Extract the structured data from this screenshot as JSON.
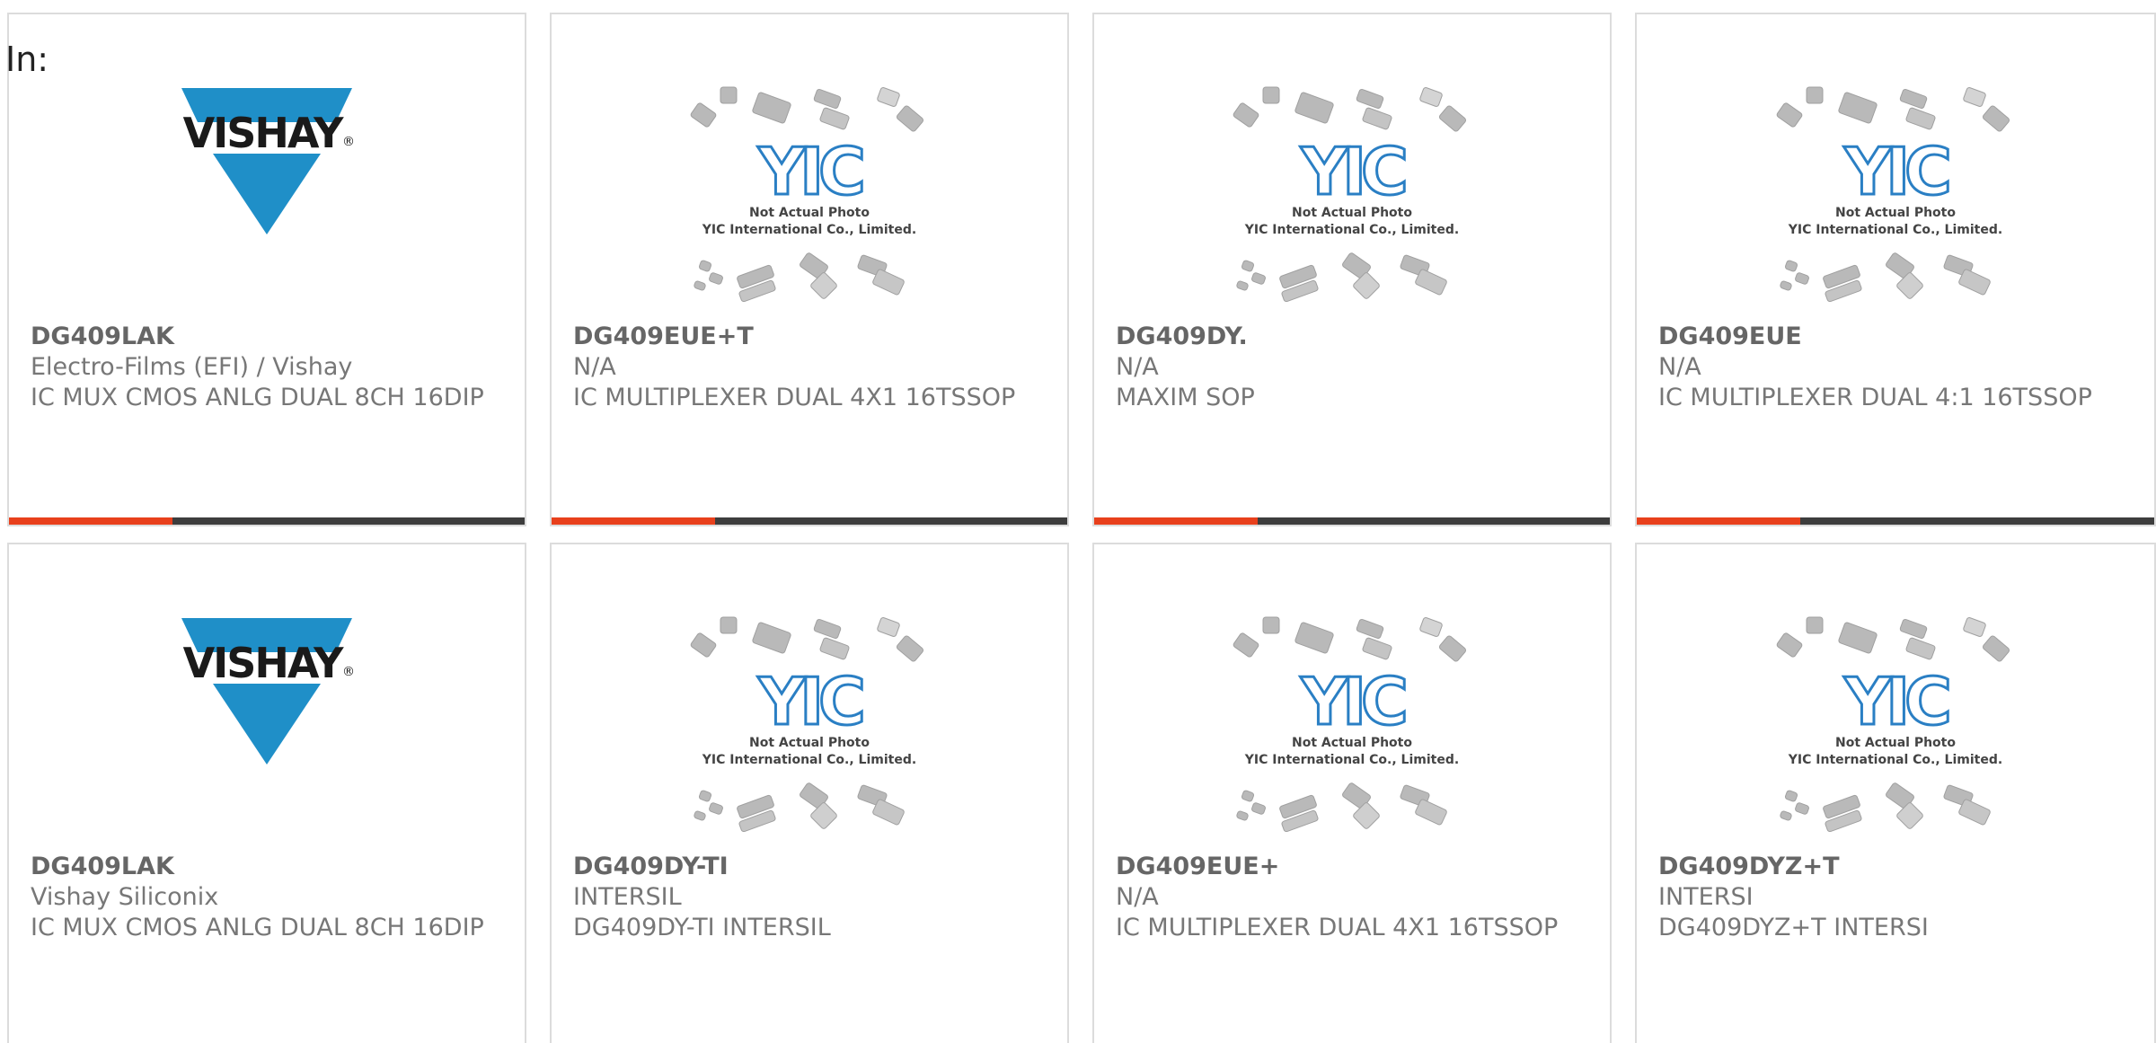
{
  "page": {
    "prefix_label": "In:"
  },
  "colors": {
    "accent": "#e8401c",
    "bar_dark": "#3d3d3d",
    "vishay_blue": "#1f8fc8",
    "yic_blue": "#2a7fc4"
  },
  "generic_image": {
    "caption_line1": "Not Actual Photo",
    "caption_line2": "YIC International Co., Limited.",
    "logo_text": "YIC"
  },
  "vishay_logo": {
    "text": "VISHAY",
    "mark": "®"
  },
  "products": [
    {
      "part_number": "DG409LAK",
      "manufacturer": "Electro-Films (EFI) / Vishay",
      "description": "IC MUX CMOS ANLG DUAL 8CH 16DIP",
      "image": "vishay-logo",
      "has_bar": true
    },
    {
      "part_number": "DG409EUE+T",
      "manufacturer": "N/A",
      "description": "IC MULTIPLEXER DUAL 4X1 16TSSOP",
      "image": "generic-chip-image",
      "has_bar": true
    },
    {
      "part_number": "DG409DY.",
      "manufacturer": "N/A",
      "description": "MAXIM SOP",
      "image": "generic-chip-image",
      "has_bar": true
    },
    {
      "part_number": "DG409EUE",
      "manufacturer": "N/A",
      "description": "IC MULTIPLEXER DUAL 4:1 16TSSOP",
      "image": "generic-chip-image",
      "has_bar": true
    },
    {
      "part_number": "DG409LAK",
      "manufacturer": "Vishay Siliconix",
      "description": "IC MUX CMOS ANLG DUAL 8CH 16DIP",
      "image": "vishay-logo",
      "has_bar": false
    },
    {
      "part_number": "DG409DY-TI",
      "manufacturer": "INTERSIL",
      "description": "DG409DY-TI INTERSIL",
      "image": "generic-chip-image",
      "has_bar": false
    },
    {
      "part_number": "DG409EUE+",
      "manufacturer": "N/A",
      "description": "IC MULTIPLEXER DUAL 4X1 16TSSOP",
      "image": "generic-chip-image",
      "has_bar": false
    },
    {
      "part_number": "DG409DYZ+T",
      "manufacturer": "INTERSI",
      "description": "DG409DYZ+T INTERSI",
      "image": "generic-chip-image",
      "has_bar": false
    }
  ]
}
